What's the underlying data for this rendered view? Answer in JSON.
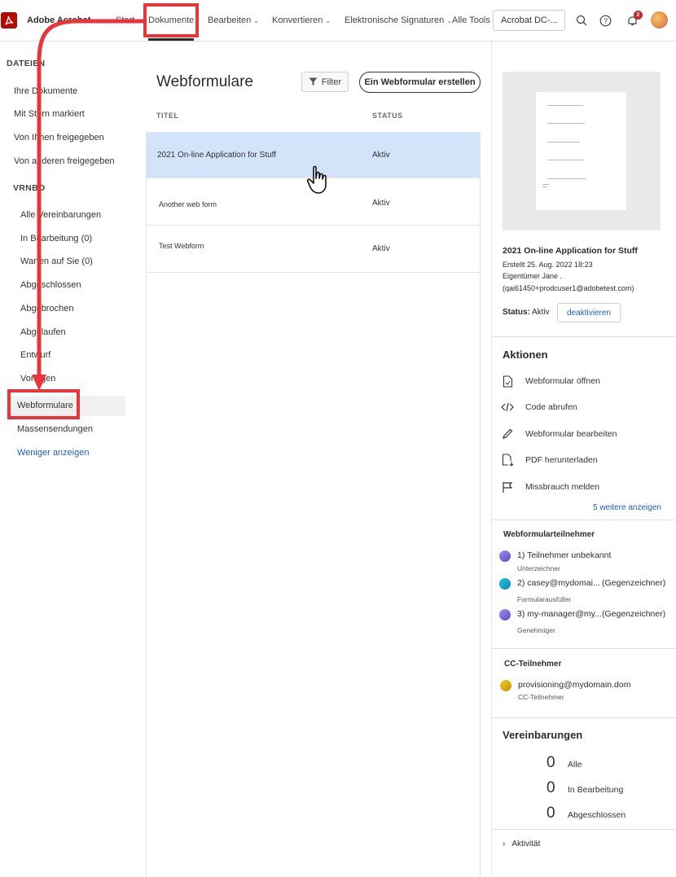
{
  "topbar": {
    "brand": "Adobe Acrobat",
    "nav": [
      {
        "label": "Start",
        "dropdown": false
      },
      {
        "label": "Dokumente",
        "dropdown": false,
        "active": true
      },
      {
        "label": "Bearbeiten",
        "dropdown": true
      },
      {
        "label": "Konvertieren",
        "dropdown": true
      },
      {
        "label": "Elektronische Signaturen",
        "dropdown": true
      },
      {
        "label": "Alle Tools",
        "dropdown": false
      }
    ],
    "search_value": "Acrobat DC-...",
    "notification_count": "2"
  },
  "sidebar": {
    "section1": "DATEIEN",
    "files": [
      "Ihre Dokumente",
      "Mit Stern markiert",
      "Von Ihnen freigegeben",
      "Von anderen freigegeben"
    ],
    "section2": "VRNBO",
    "agreements": [
      "Alle Vereinbarungen",
      "In Bearbeitung (0)",
      "Warten auf Sie (0)",
      "Abgeschlossen",
      "Abgebrochen",
      "Abgelaufen",
      "Entwurf",
      "Vorlagen"
    ],
    "webforms": "Webformulare",
    "bulk": "Massensendungen",
    "less": "Weniger anzeigen"
  },
  "main": {
    "title": "Webformulare",
    "filter": "Filter",
    "create": "Ein Webformular erstellen",
    "columns": {
      "title": "TITEL",
      "status": "STATUS"
    },
    "rows": [
      {
        "title": "2021 On-line Application for Stuff",
        "status": "Aktiv",
        "selected": true
      },
      {
        "title": "Another web form",
        "status": "Aktiv",
        "selected": false
      },
      {
        "title": "Test Webform",
        "status": "Aktiv",
        "selected": false
      }
    ]
  },
  "details": {
    "name": "2021 On-line Application for Stuff",
    "created": "Erstellt 25. Aug. 2022 18:23",
    "owner": "Eigentümer Jane .",
    "owner_email": "(qai61450+prodcuser1@adobetest.com)",
    "status_label": "Status:",
    "status_value": "Aktiv",
    "deactivate": "deaktivieren",
    "actions_title": "Aktionen",
    "actions": [
      {
        "label": "Webformular öffnen",
        "icon": "open-document-icon"
      },
      {
        "label": "Code abrufen",
        "icon": "code-icon"
      },
      {
        "label": "Webformular bearbeiten",
        "icon": "pencil-icon"
      },
      {
        "label": "PDF herunterladen",
        "icon": "pdf-download-icon"
      },
      {
        "label": "Missbrauch melden",
        "icon": "flag-icon"
      }
    ],
    "more": "5 weitere anzeigen",
    "participants_title": "Webformularteilnehmer",
    "participants": [
      {
        "name": "1) Teilnehmer unbekannt",
        "extra": "",
        "role": "Unterzeichner",
        "color": "#7b6fd8"
      },
      {
        "name": "2) casey@mydomai...",
        "extra": "(Gegenzeichner)",
        "role": "Formularausfüller",
        "color": "#1aa6c9"
      },
      {
        "name": "3) my-manager@my...",
        "extra": "(Gegenzeichner)",
        "role": "Genehmiger",
        "color": "#7b6fd8"
      }
    ],
    "cc_title": "CC-Teilnehmer",
    "cc": {
      "email": "provisioning@mydomain.dom",
      "role": "CC-Teilnehmer",
      "color": "#d9a800"
    },
    "agreements_title": "Vereinbarungen",
    "counts": [
      {
        "value": "0",
        "label": "Alle"
      },
      {
        "value": "0",
        "label": "In Bearbeitung"
      },
      {
        "value": "0",
        "label": "Abgeschlossen"
      }
    ],
    "activity": "Aktivität"
  },
  "colors": {
    "accent_link": "#1d5dc4",
    "annotation_red": "#e8343b",
    "selected_row": "#d2e3fa",
    "brand_red": "#b30b00"
  }
}
